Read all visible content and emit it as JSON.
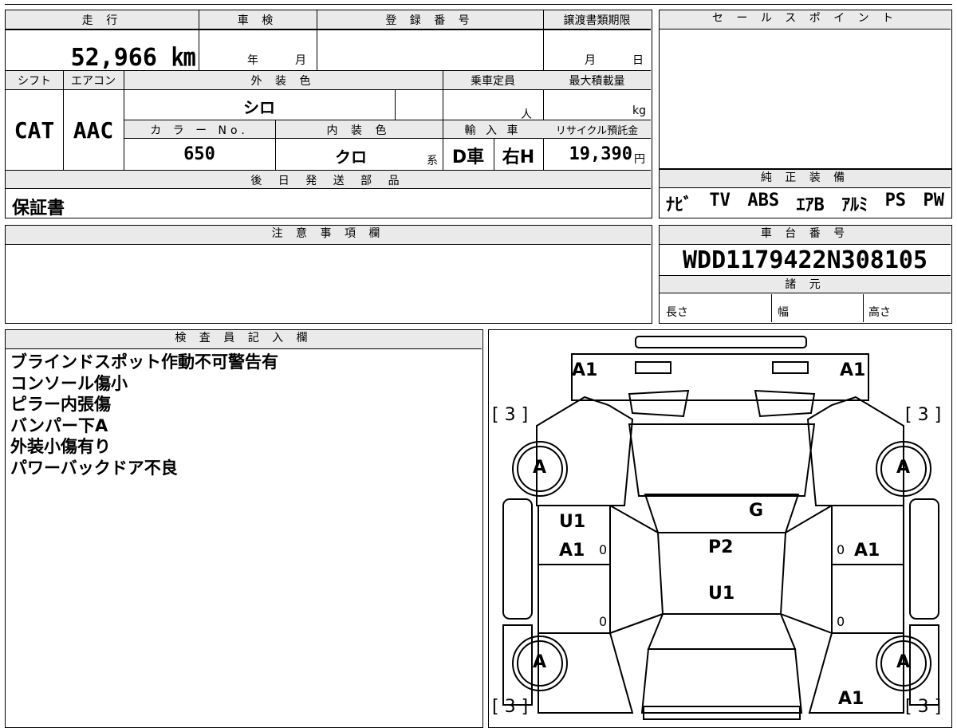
{
  "header": {
    "mileage_label": "走 行",
    "mileage_value": "52,966 ㎞",
    "shaken_label": "車 検",
    "shaken_year": "年",
    "shaken_month": "月",
    "registration_label": "登 録 番 号",
    "transfer_label": "譲渡書類期限",
    "transfer_month": "月",
    "transfer_day": "日",
    "shift_label": "シフト",
    "shift_value": "CAT",
    "aircon_label": "エアコン",
    "aircon_value": "AAC",
    "exterior_color_label": "外 装 色",
    "exterior_color_value": "シロ",
    "capacity_label": "乗車定員",
    "capacity_unit": "人",
    "max_load_label": "最大積載量",
    "max_load_unit": "kg",
    "color_no_label": "カ ラ ー No.",
    "color_no_value": "650",
    "interior_color_label": "内 装 色",
    "interior_color_value": "クロ",
    "interior_suffix": "系",
    "import_label": "輸 入 車",
    "import_value_1": "D車",
    "import_value_2": "右H",
    "recycle_label": "リサイクル預託金",
    "recycle_value": "19,390",
    "recycle_unit": "円",
    "later_parts_label": "後 日 発 送 部 品",
    "later_parts_value": "保証書"
  },
  "sales_point": {
    "label": "セ ー ル ス ポ イ ン ト"
  },
  "equipment": {
    "label": "純 正 装 備",
    "items": [
      "ﾅﾋﾞ",
      "TV",
      "ABS",
      "ｴｱB",
      "ｱﾙﾐ",
      "PS",
      "PW"
    ]
  },
  "caution": {
    "label": "注 意 事 項 欄"
  },
  "chassis": {
    "label": "車 台 番 号",
    "value": "WDD1179422N308105",
    "spec_label": "諸 元",
    "length_label": "長さ",
    "width_label": "幅",
    "height_label": "高さ"
  },
  "inspector": {
    "label": "検 査 員 記 入 欄",
    "notes": [
      "ブラインドスポット作動不可警告有",
      "コンソール傷小",
      "ピラー内張傷",
      "バンパー下A",
      "外装小傷有り",
      "パワーバックドア不良"
    ]
  },
  "diagram": {
    "front_left": "A1",
    "front_right": "A1",
    "bracket_tl": "[ 3 ]",
    "bracket_tr": "[ 3 ]",
    "bracket_bl": "[ 3 ]",
    "bracket_br": "[ 3 ]",
    "tire_fl": "A",
    "tire_fr": "A",
    "tire_rl": "A",
    "tire_rr": "A",
    "hood": "G",
    "left_door_1": "U1",
    "left_door_2": "A1",
    "roof_1": "P2",
    "roof_2": "U1",
    "right_door": "A1",
    "rear_right": "A1",
    "zero_1": "0",
    "zero_2": "0",
    "zero_3": "0",
    "zero_4": "0"
  }
}
